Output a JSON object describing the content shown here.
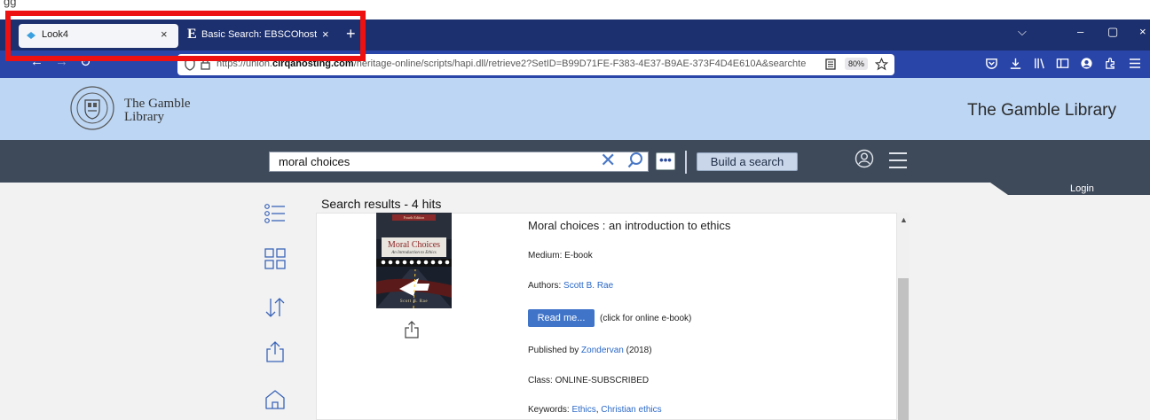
{
  "browser": {
    "top_fragment": "gg",
    "tabs": [
      {
        "title": "Look4",
        "close": "×"
      },
      {
        "title": "Basic Search: EBSCOhost",
        "close": "×",
        "favicon_letter": "E"
      }
    ],
    "new_tab": "+",
    "window_controls": {
      "dropdown": "⌵",
      "minimize": "–",
      "restore": "▢",
      "close": "×"
    },
    "nav": {
      "back": "←",
      "forward": "→",
      "reload": "↻"
    },
    "url_prefix": "https://union.",
    "url_bold": "cirqahosting.com",
    "url_suffix": "/heritage-online/scripts/hapi.dll/retrieve2?SetID=B99D71FE-F383-4E37-B9AE-373F4D4E610A&searchte",
    "zoom": "80%",
    "extension_icons": [
      "pocket-icon",
      "downloads-icon",
      "library-icon",
      "sidebar-icon",
      "account-icon",
      "extensions-icon",
      "menu-icon"
    ]
  },
  "header": {
    "library_name_left_line1": "The Gamble",
    "library_name_left_line2": "Library",
    "library_name_right": "The Gamble Library"
  },
  "search": {
    "query": "moral choices",
    "clear_glyph": "✕",
    "more_glyph": "•••",
    "build_label": "Build a search"
  },
  "login_label": "Login",
  "results": {
    "heading": "Search results - 4 hits",
    "item": {
      "title": "Moral choices : an introduction to ethics",
      "medium_label": "Medium: ",
      "medium": "E-book",
      "authors_label": "Authors: ",
      "author": "Scott B. Rae",
      "read_button": "Read me...",
      "read_note": "(click for online e-book)",
      "published_label": "Published by ",
      "publisher": "Zondervan",
      "year": " (2018)",
      "class_label": "Class: ",
      "class_value": "ONLINE-SUBSCRIBED",
      "keywords_label": "Keywords: ",
      "keyword1": "Ethics",
      "keyword_sep": ", ",
      "keyword2": "Christian ethics",
      "cover": {
        "edition": "Fourth Edition",
        "title": "Moral Choices",
        "subtitle": "An Introduction to Ethics",
        "author": "Scott B. Rae"
      }
    }
  },
  "colors": {
    "tabbar": "#1c2f6e",
    "navbar": "#2a45a8",
    "header_bg": "#bdd6f3",
    "searchbar_bg": "#3e4a5a",
    "accent": "#3f74c9",
    "highlight": "#ee1111"
  }
}
